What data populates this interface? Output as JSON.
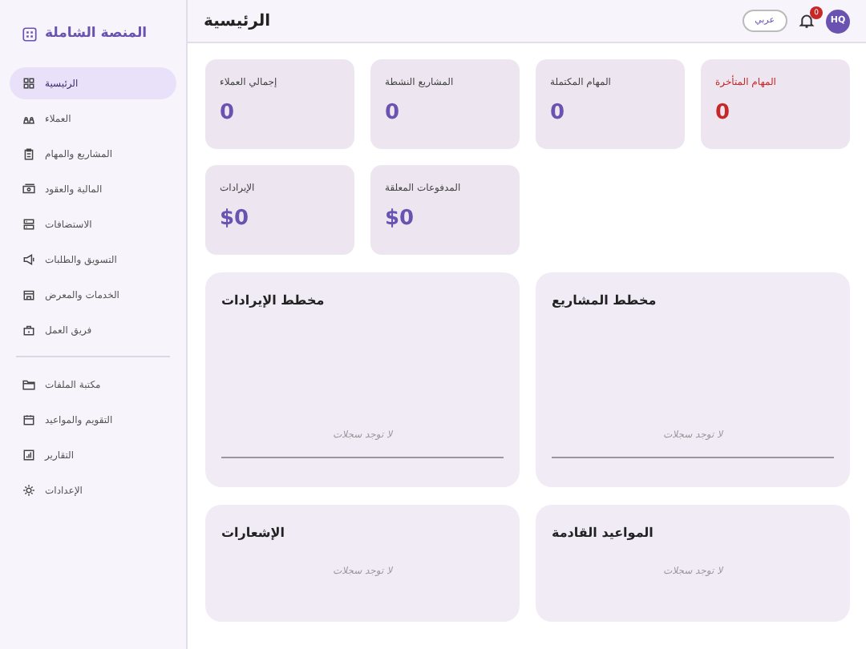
{
  "sidebar": {
    "title": "المنصة الشاملة",
    "items": [
      {
        "label": "الرئيسية",
        "selected": true
      },
      {
        "label": "العملاء",
        "selected": false
      },
      {
        "label": "المشاريع والمهام",
        "selected": false
      },
      {
        "label": "المالية والعقود",
        "selected": false
      },
      {
        "label": "الاستضافات",
        "selected": false
      },
      {
        "label": "التسويق والطلبات",
        "selected": false
      },
      {
        "label": "الخدمات والمعرض",
        "selected": false
      },
      {
        "label": "فريق العمل",
        "selected": false
      }
    ],
    "items_2": [
      {
        "label": "مكتبة الملفات",
        "selected": false
      },
      {
        "label": "التقويم والمواعيد",
        "selected": false
      },
      {
        "label": "التقارير",
        "selected": false
      },
      {
        "label": "الإعدادات",
        "selected": false
      }
    ]
  },
  "header": {
    "title": "الرئيسية",
    "language": "عربي",
    "notification_count": "0",
    "avatar": "HQ"
  },
  "stats": [
    {
      "label": "المهام المتأخرة",
      "value": "0",
      "kind": "alert"
    },
    {
      "label": "المهام المكتملة",
      "value": "0",
      "kind": "normal"
    },
    {
      "label": "المشاريع النشطة",
      "value": "0",
      "kind": "normal"
    },
    {
      "label": "إجمالي العملاء",
      "value": "0",
      "kind": "normal"
    },
    {
      "label": "المدفوعات المعلقة",
      "value": "$0",
      "kind": "normal"
    },
    {
      "label": "الإيرادات",
      "value": "$0",
      "kind": "normal"
    }
  ],
  "panels": [
    {
      "title": "مخطط المشاريع",
      "empty_text": "لا توجد سجلات",
      "kind": "chart"
    },
    {
      "title": "مخطط الإيرادات",
      "empty_text": "لا توجد سجلات",
      "kind": "chart"
    },
    {
      "title": "المواعيد القادمة",
      "empty_text": "لا توجد سجلات",
      "kind": "list"
    },
    {
      "title": "الإشعارات",
      "empty_text": "لا توجد سجلات",
      "kind": "list"
    }
  ]
}
